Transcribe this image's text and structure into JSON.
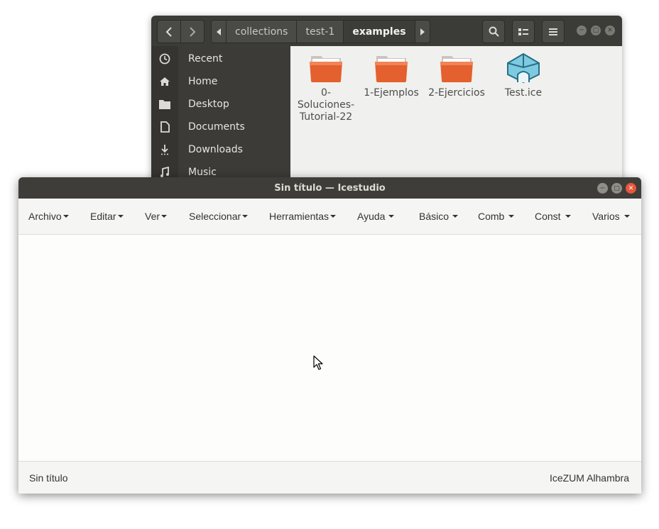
{
  "file_manager": {
    "breadcrumbs": [
      "collections",
      "test-1",
      "examples"
    ],
    "sidebar": [
      {
        "label": "Recent",
        "icon": "clock-icon"
      },
      {
        "label": "Home",
        "icon": "home-icon"
      },
      {
        "label": "Desktop",
        "icon": "folder-icon"
      },
      {
        "label": "Documents",
        "icon": "document-icon"
      },
      {
        "label": "Downloads",
        "icon": "download-icon"
      },
      {
        "label": "Music",
        "icon": "music-icon"
      }
    ],
    "files": [
      {
        "line1": "0-",
        "line2": "Soluciones-",
        "line3": "Tutorial-22",
        "icon": "folder-icon"
      },
      {
        "line1": "1-Ejemplos",
        "icon": "folder-icon"
      },
      {
        "line1": "2-Ejercicios",
        "icon": "folder-icon"
      },
      {
        "line1": "Test.ice",
        "icon": "icestudio-file-icon"
      }
    ],
    "colors": {
      "folder": "#e4602f",
      "header": "#3b3b38",
      "sidebar": "#3c3b37"
    }
  },
  "icestudio": {
    "title": "Sin título — Icestudio",
    "menus": [
      "Archivo",
      "Editar",
      "Ver",
      "Seleccionar",
      "Herramientas",
      "Ayuda",
      "Básico",
      "Comb",
      "Const",
      "Varios"
    ],
    "status_left": "Sin título",
    "status_right": "IceZUM Alhambra",
    "colors": {
      "close": "#e8573d",
      "titlebar": "#3e3d39"
    }
  }
}
